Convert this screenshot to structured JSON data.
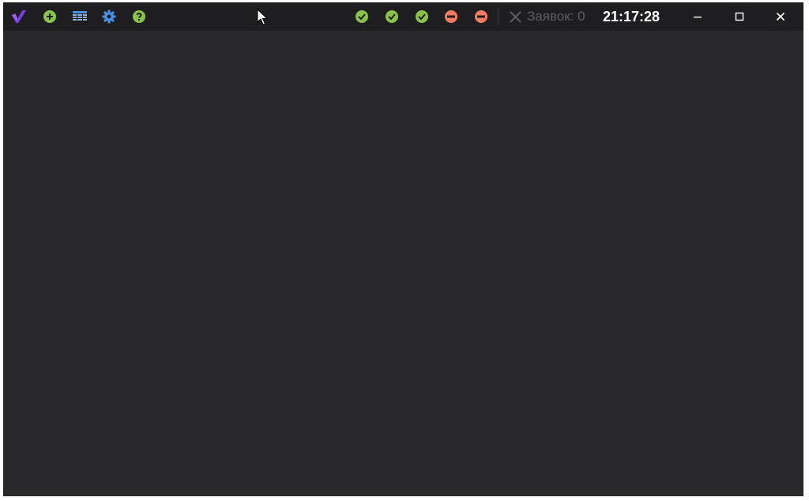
{
  "toolbar": {
    "icons": [
      "app-logo-icon",
      "add-icon",
      "table-icon",
      "settings-icon",
      "help-icon"
    ]
  },
  "status_indicators": [
    {
      "state": "ok",
      "icon": "check-icon"
    },
    {
      "state": "ok",
      "icon": "check-icon"
    },
    {
      "state": "ok",
      "icon": "check-icon"
    },
    {
      "state": "error",
      "icon": "minus-icon"
    },
    {
      "state": "error",
      "icon": "minus-icon"
    }
  ],
  "requests": {
    "label": "Заявок: 0"
  },
  "clock": {
    "time": "21:17:28"
  },
  "window_controls": [
    "minimize-icon",
    "maximize-icon",
    "close-icon"
  ],
  "colors": {
    "background": "#29292b",
    "titlebar": "#1e1e20",
    "ok": "#8bc34a",
    "error": "#f27b62",
    "logo": "#7b3fe4",
    "settings": "#4a90e2"
  }
}
